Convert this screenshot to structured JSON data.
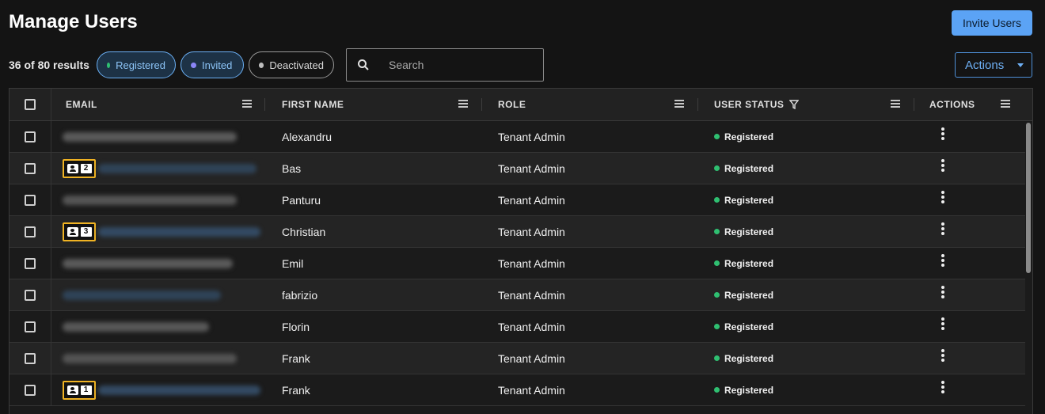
{
  "header": {
    "title": "Manage Users",
    "invite_label": "Invite Users"
  },
  "toolbar": {
    "result_count": "36 of 80 results",
    "filters": [
      {
        "label": "Registered",
        "color": "#2fbf71"
      },
      {
        "label": "Invited",
        "color": "#8b86f7"
      },
      {
        "label": "Deactivated",
        "color": "#bdbdbd"
      }
    ],
    "search_placeholder": "Search",
    "actions_label": "Actions"
  },
  "table": {
    "columns": [
      "EMAIL",
      "FIRST NAME",
      "ROLE",
      "USER STATUS",
      "ACTIONS"
    ],
    "rows": [
      {
        "first_name": "Alexandru",
        "role": "Tenant Admin",
        "status": "Registered",
        "badge": ""
      },
      {
        "first_name": "Bas",
        "role": "Tenant Admin",
        "status": "Registered",
        "badge": "2"
      },
      {
        "first_name": "Panturu",
        "role": "Tenant Admin",
        "status": "Registered",
        "badge": ""
      },
      {
        "first_name": "Christian",
        "role": "Tenant Admin",
        "status": "Registered",
        "badge": "3"
      },
      {
        "first_name": "Emil",
        "role": "Tenant Admin",
        "status": "Registered",
        "badge": ""
      },
      {
        "first_name": "fabrizio",
        "role": "Tenant Admin",
        "status": "Registered",
        "badge": ""
      },
      {
        "first_name": "Florin",
        "role": "Tenant Admin",
        "status": "Registered",
        "badge": ""
      },
      {
        "first_name": "Frank",
        "role": "Tenant Admin",
        "status": "Registered",
        "badge": ""
      },
      {
        "first_name": "Frank",
        "role": "Tenant Admin",
        "status": "Registered",
        "badge": "1"
      }
    ]
  },
  "colors": {
    "accent": "#5ba3f5",
    "registered": "#2fbf71",
    "badge_border": "#f0b323"
  }
}
